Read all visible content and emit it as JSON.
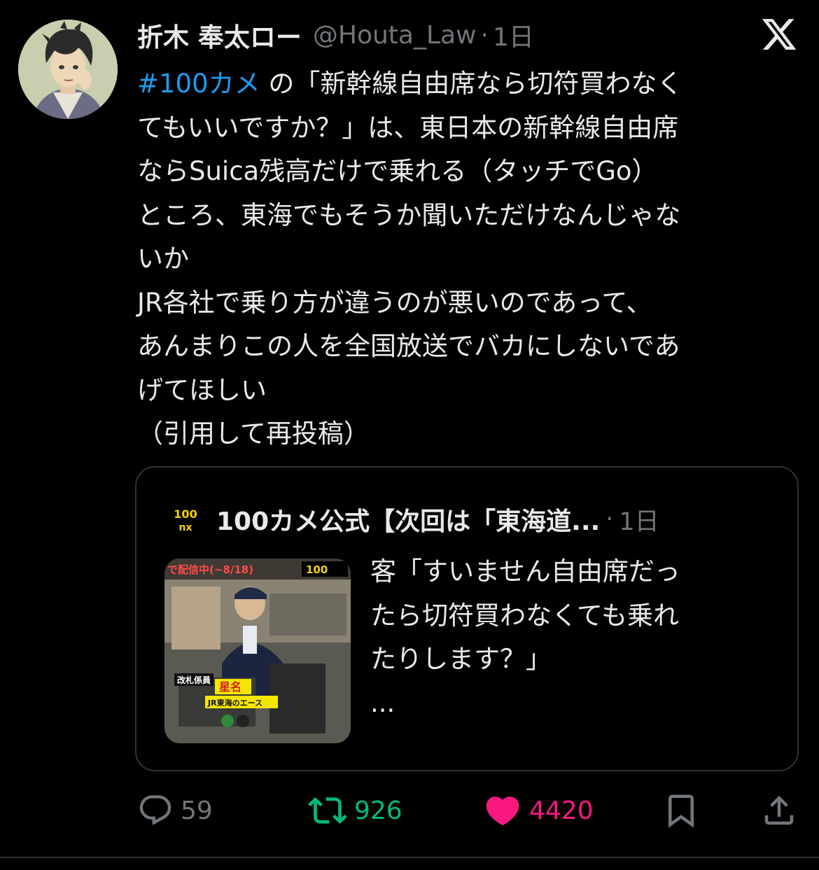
{
  "tweet": {
    "author": {
      "display_name": "折木 奉太ロー",
      "handle": "@Houta_Law",
      "separator": "·",
      "time": "1日"
    },
    "hashtag": "#100カメ",
    "body": " の「新幹線自由席なら切符買わなく\nてもいいですか？」は、東日本の新幹線自由席\nならSuica残高だけで乗れる（タッチでGo）\nところ、東海でもそうか聞いただけなんじゃな\nいか\nJR各社で乗り方が違うのが悪いのであって、\nあんまりこの人を全国放送でバカにしないであ\nげてほしい\n（引用して再投稿）",
    "quote": {
      "display_name": "100カメ公式【次回は「東海道...",
      "separator": "·",
      "time": "1日",
      "text": "客「すいません自由席だっ\nたら切符買わなくても乗れ\nたりします？」\n...",
      "thumbnail": {
        "banner_text": "で配信中(~8/18)",
        "logo_text": "100",
        "caption_role": "改札係員",
        "caption_name": "星名",
        "caption_sub": "JR東海のエース"
      }
    },
    "actions": {
      "replies": "59",
      "reposts": "926",
      "likes": "4420"
    }
  },
  "colors": {
    "background": "#000000",
    "text": "#e7e9ea",
    "secondary": "#71767b",
    "link": "#1d9bf0",
    "repost": "#00ba7c",
    "like": "#f91880",
    "border": "#2f3336"
  },
  "icons": [
    "x-logo-icon",
    "reply-icon",
    "repost-icon",
    "heart-icon",
    "bookmark-icon",
    "share-icon"
  ]
}
